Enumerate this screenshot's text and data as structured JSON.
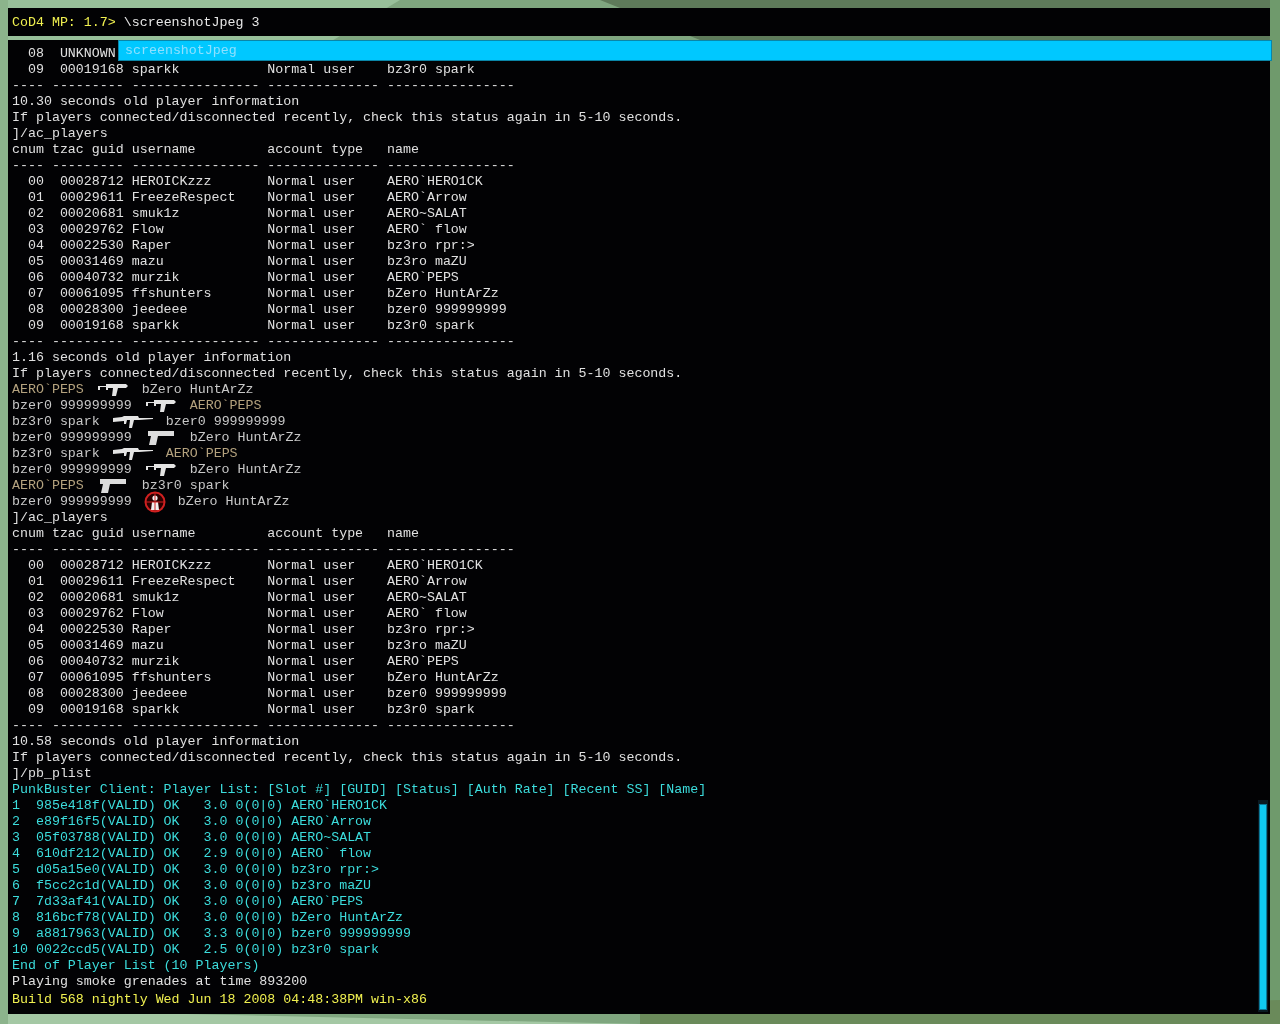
{
  "console_input": {
    "prompt": "CoD4 MP: 1.7>",
    "command": "\\screenshotJpeg 3"
  },
  "autocomplete": {
    "suggestion": "screenshotJpeg"
  },
  "output_lines": [
    {
      "kind": "info",
      "text": "  08  UNKNOWN"
    },
    {
      "kind": "info",
      "text": "  09  00019168 sparkk           Normal user    bz3r0 spark"
    },
    {
      "kind": "info",
      "text": "---- --------- ---------------- -------------- ----------------"
    },
    {
      "kind": "info",
      "text": "10.30 seconds old player information"
    },
    {
      "kind": "info",
      "text": "If players connected/disconnected recently, check this status again in 5-10 seconds."
    },
    {
      "kind": "info",
      "text": "]/ac_players"
    },
    {
      "kind": "info",
      "text": "cnum tzac guid username         account type   name"
    },
    {
      "kind": "info",
      "text": "---- --------- ---------------- -------------- ----------------"
    },
    {
      "kind": "info",
      "text": "  00  00028712 HEROICKzzz       Normal user    AERO`HERO1CK"
    },
    {
      "kind": "info",
      "text": "  01  00029611 FreezeRespect    Normal user    AERO`Arrow"
    },
    {
      "kind": "info",
      "text": "  02  00020681 smuk1z           Normal user    AERO~SALAT"
    },
    {
      "kind": "info",
      "text": "  03  00029762 Flow             Normal user    AERO` flow"
    },
    {
      "kind": "info",
      "text": "  04  00022530 Raper            Normal user    bz3ro rpr:>"
    },
    {
      "kind": "info",
      "text": "  05  00031469 mazu             Normal user    bz3ro maZU"
    },
    {
      "kind": "info",
      "text": "  06  00040732 murzik           Normal user    AERO`PEPS"
    },
    {
      "kind": "info",
      "text": "  07  00061095 ffshunters       Normal user    bZero HuntArZz"
    },
    {
      "kind": "info",
      "text": "  08  00028300 jeedeee          Normal user    bzer0 999999999"
    },
    {
      "kind": "info",
      "text": "  09  00019168 sparkk           Normal user    bz3r0 spark"
    },
    {
      "kind": "info",
      "text": "---- --------- ---------------- -------------- ----------------"
    },
    {
      "kind": "info",
      "text": "1.16 seconds old player information"
    },
    {
      "kind": "info",
      "text": "If players connected/disconnected recently, check this status again in 5-10 seconds."
    },
    {
      "kind": "smg",
      "attacker": {
        "name": "AERO`PEPS",
        "color": "#b4a27e"
      },
      "victim": {
        "name": "bZero HuntArZz",
        "color": "#c8c8c8"
      }
    },
    {
      "kind": "smg",
      "attacker": {
        "name": "bzer0 999999999",
        "color": "#c8c8c8"
      },
      "victim": {
        "name": "AERO`PEPS",
        "color": "#b4a27e"
      }
    },
    {
      "kind": "rifle",
      "attacker": {
        "name": "bz3r0 spark",
        "color": "#c8c8c8"
      },
      "victim": {
        "name": "bzer0 999999999",
        "color": "#c8c8c8"
      }
    },
    {
      "kind": "pistol",
      "attacker": {
        "name": "bzer0 999999999",
        "color": "#c8c8c8"
      },
      "victim": {
        "name": "bZero HuntArZz",
        "color": "#c8c8c8"
      }
    },
    {
      "kind": "rifle",
      "attacker": {
        "name": "bz3r0 spark",
        "color": "#c8c8c8"
      },
      "victim": {
        "name": "AERO`PEPS",
        "color": "#b4a27e"
      }
    },
    {
      "kind": "smg",
      "attacker": {
        "name": "bzer0 999999999",
        "color": "#c8c8c8"
      },
      "victim": {
        "name": "bZero HuntArZz",
        "color": "#c8c8c8"
      }
    },
    {
      "kind": "pistol",
      "attacker": {
        "name": "AERO`PEPS",
        "color": "#b4a27e"
      },
      "victim": {
        "name": "bz3r0 spark",
        "color": "#c8c8c8"
      }
    },
    {
      "kind": "headshot",
      "attacker": {
        "name": "bzer0 999999999",
        "color": "#c8c8c8"
      },
      "victim": {
        "name": "bZero HuntArZz",
        "color": "#c8c8c8"
      }
    },
    {
      "kind": "info",
      "text": "]/ac_players"
    },
    {
      "kind": "info",
      "text": "cnum tzac guid username         account type   name"
    },
    {
      "kind": "info",
      "text": "---- --------- ---------------- -------------- ----------------"
    },
    {
      "kind": "info",
      "text": "  00  00028712 HEROICKzzz       Normal user    AERO`HERO1CK"
    },
    {
      "kind": "info",
      "text": "  01  00029611 FreezeRespect    Normal user    AERO`Arrow"
    },
    {
      "kind": "info",
      "text": "  02  00020681 smuk1z           Normal user    AERO~SALAT"
    },
    {
      "kind": "info",
      "text": "  03  00029762 Flow             Normal user    AERO` flow"
    },
    {
      "kind": "info",
      "text": "  04  00022530 Raper            Normal user    bz3ro rpr:>"
    },
    {
      "kind": "info",
      "text": "  05  00031469 mazu             Normal user    bz3ro maZU"
    },
    {
      "kind": "info",
      "text": "  06  00040732 murzik           Normal user    AERO`PEPS"
    },
    {
      "kind": "info",
      "text": "  07  00061095 ffshunters       Normal user    bZero HuntArZz"
    },
    {
      "kind": "info",
      "text": "  08  00028300 jeedeee          Normal user    bzer0 999999999"
    },
    {
      "kind": "info",
      "text": "  09  00019168 sparkk           Normal user    bz3r0 spark"
    },
    {
      "kind": "info",
      "text": "---- --------- ---------------- -------------- ----------------"
    },
    {
      "kind": "info",
      "text": "10.58 seconds old player information"
    },
    {
      "kind": "info",
      "text": "If players connected/disconnected recently, check this status again in 5-10 seconds."
    },
    {
      "kind": "info",
      "text": "]/pb_plist"
    },
    {
      "kind": "punkbuster",
      "text": "PunkBuster Client: Player List: [Slot #] [GUID] [Status] [Auth Rate] [Recent SS] [Name]"
    },
    {
      "kind": "punkbuster",
      "text": "1  985e418f(VALID) OK   3.0 0(0|0) AERO`HERO1CK"
    },
    {
      "kind": "punkbuster",
      "text": "2  e89f16f5(VALID) OK   3.0 0(0|0) AERO`Arrow"
    },
    {
      "kind": "punkbuster",
      "text": "3  05f03788(VALID) OK   3.0 0(0|0) AERO~SALAT"
    },
    {
      "kind": "punkbuster",
      "text": "4  610df212(VALID) OK   2.9 0(0|0) AERO` flow"
    },
    {
      "kind": "punkbuster",
      "text": "5  d05a15e0(VALID) OK   3.0 0(0|0) bz3ro rpr:>"
    },
    {
      "kind": "punkbuster",
      "text": "6  f5cc2c1d(VALID) OK   3.0 0(0|0) bz3ro maZU"
    },
    {
      "kind": "punkbuster",
      "text": "7  7d33af41(VALID) OK   3.0 0(0|0) AERO`PEPS"
    },
    {
      "kind": "punkbuster",
      "text": "8  816bcf78(VALID) OK   3.0 0(0|0) bZero HuntArZz"
    },
    {
      "kind": "punkbuster",
      "text": "9  a8817963(VALID) OK   3.3 0(0|0) bzer0 999999999"
    },
    {
      "kind": "punkbuster",
      "text": "10 0022ccd5(VALID) OK   2.5 0(0|0) bz3r0 spark"
    },
    {
      "kind": "punkbuster",
      "text": "End of Player List (10 Players)"
    },
    {
      "kind": "info",
      "text": "Playing smoke grenades at time 893200"
    }
  ],
  "build_info": "Build 568 nightly Wed Jun 18 2008 04:48:38PM win-x86"
}
